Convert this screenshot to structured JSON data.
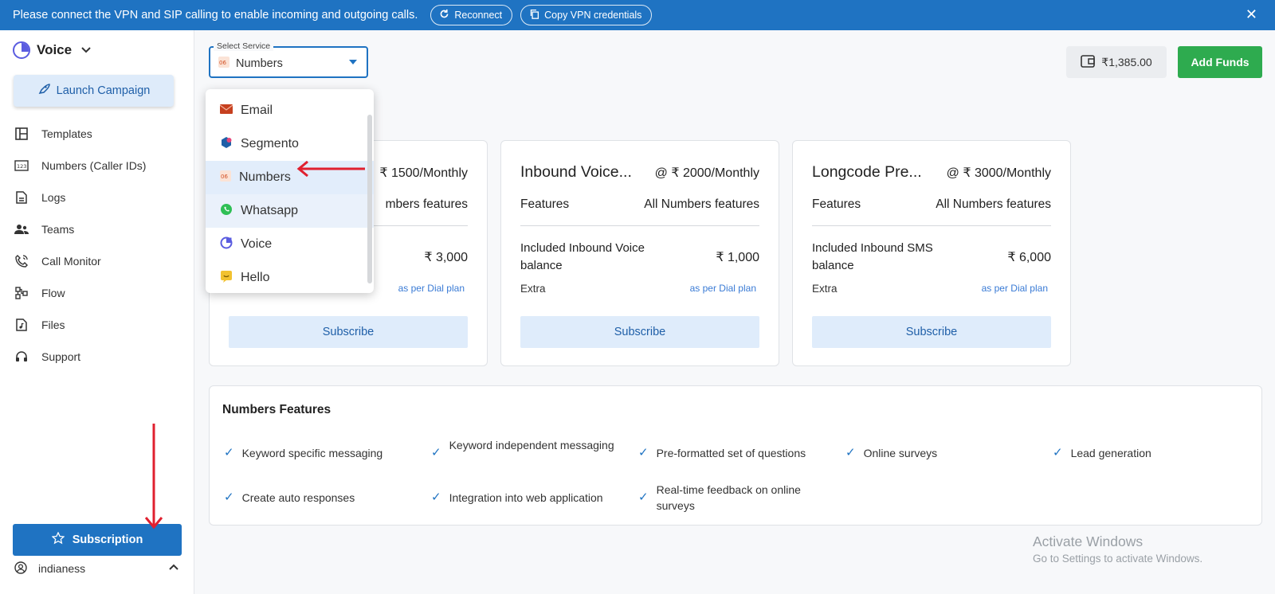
{
  "banner": {
    "message": "Please connect the VPN and SIP calling to enable incoming and outgoing calls.",
    "reconnect_label": "Reconnect",
    "copy_label": "Copy VPN credentials",
    "close_symbol": "✕"
  },
  "sidebar": {
    "product": "Voice",
    "launch_label": "Launch Campaign",
    "items": [
      {
        "label": "Templates",
        "icon": "templates-icon"
      },
      {
        "label": "Numbers (Caller IDs)",
        "icon": "numbers-icon"
      },
      {
        "label": "Logs",
        "icon": "logs-icon"
      },
      {
        "label": "Teams",
        "icon": "teams-icon"
      },
      {
        "label": "Call Monitor",
        "icon": "call-monitor-icon"
      },
      {
        "label": "Flow",
        "icon": "flow-icon"
      },
      {
        "label": "Files",
        "icon": "files-icon"
      },
      {
        "label": "Support",
        "icon": "support-icon"
      }
    ],
    "subscription_label": "Subscription",
    "user": "indianess"
  },
  "select": {
    "label": "Select Service",
    "value": "Numbers"
  },
  "dropdown": {
    "options": [
      "Email",
      "Segmento",
      "Numbers",
      "Whatsapp",
      "Voice",
      "Hello"
    ],
    "selected": "Numbers"
  },
  "wallet": {
    "balance": "₹1,385.00",
    "add_funds_label": "Add Funds"
  },
  "cards": [
    {
      "title": "",
      "price": "₹ 1500/Monthly",
      "features_label": "",
      "features_value": "mbers features",
      "included": "",
      "amount": "₹ 3,000",
      "extra_label": "",
      "extra_value": "as per Dial plan",
      "cta": "Subscribe"
    },
    {
      "title": "Inbound Voice...",
      "price": "@ ₹ 2000/Monthly",
      "features_label": "Features",
      "features_value": "All Numbers features",
      "included": "Included Inbound Voice balance",
      "amount": "₹ 1,000",
      "extra_label": "Extra",
      "extra_value": "as per Dial plan",
      "cta": "Subscribe"
    },
    {
      "title": "Longcode Pre...",
      "price": "@ ₹ 3000/Monthly",
      "features_label": "Features",
      "features_value": "All Numbers features",
      "included": "Included Inbound SMS balance",
      "amount": "₹ 6,000",
      "extra_label": "Extra",
      "extra_value": "as per Dial plan",
      "cta": "Subscribe"
    }
  ],
  "features": {
    "title": "Numbers Features",
    "items": [
      "Keyword specific messaging",
      "Keyword independent messaging",
      "Pre-formatted set of questions",
      "Online surveys",
      "Lead generation",
      "Create auto responses",
      "Integration into web application",
      "Real-time feedback on online surveys"
    ]
  },
  "watermark": {
    "line1": "Activate Windows",
    "line2": "Go to Settings to activate Windows."
  },
  "colors": {
    "primary": "#1f73c2",
    "success": "#2eab4f",
    "annotation": "#e0202f"
  }
}
